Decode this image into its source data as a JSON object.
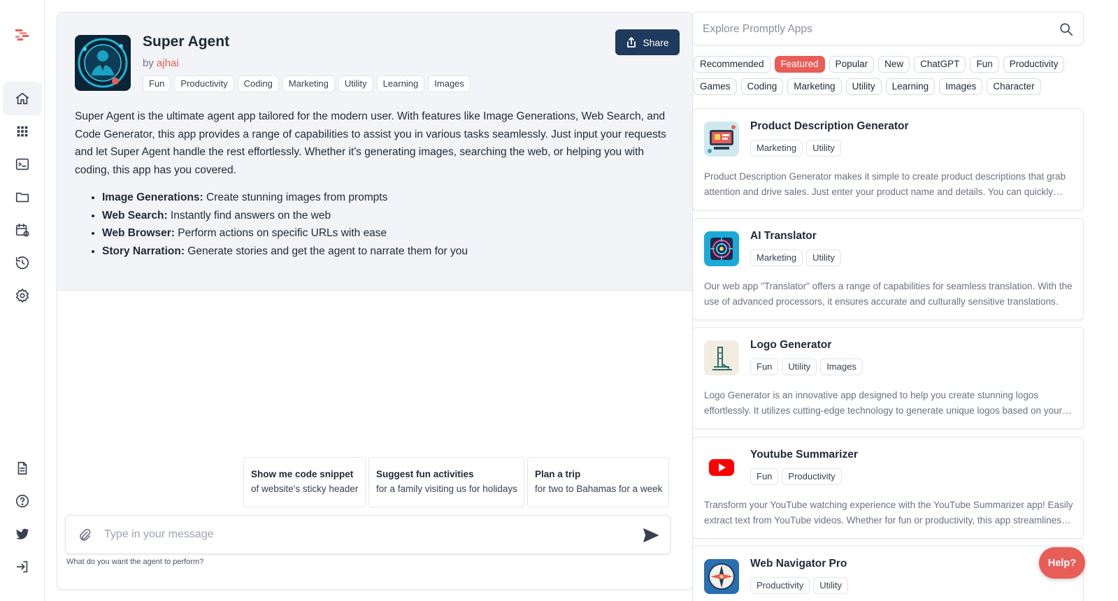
{
  "rail": {
    "items": [
      "home",
      "apps",
      "terminal",
      "folder",
      "calendar",
      "history",
      "settings",
      "docs",
      "help",
      "twitter",
      "login"
    ]
  },
  "agent": {
    "title": "Super Agent",
    "by_prefix": "by",
    "author": "ajhai",
    "tags": [
      "Fun",
      "Productivity",
      "Coding",
      "Marketing",
      "Utility",
      "Learning",
      "Images"
    ],
    "share_label": "Share",
    "description": "Super Agent is the ultimate agent app tailored for the modern user. With features like Image Generations, Web Search, and Code Generator, this app provides a range of capabilities to assist you in various tasks seamlessly. Just input your requests and let Super Agent handle the rest effortlessly. Whether it's generating images, searching the web, or helping you with coding, this app has you covered.",
    "features": [
      {
        "name": "Image Generations:",
        "text": "Create stunning images from prompts"
      },
      {
        "name": "Web Search:",
        "text": "Instantly find answers on the web"
      },
      {
        "name": "Web Browser:",
        "text": "Perform actions on specific URLs with ease"
      },
      {
        "name": "Story Narration:",
        "text": "Generate stories and get the agent to narrate them for you"
      }
    ]
  },
  "suggestions": [
    {
      "title": "Show me code snippet",
      "sub": "of website's sticky header"
    },
    {
      "title": "Suggest fun activities",
      "sub": "for a family visiting us for holidays"
    },
    {
      "title": "Plan a trip",
      "sub": "for two to Bahamas for a week"
    }
  ],
  "composer": {
    "placeholder": "Type in your message",
    "hint": "What do you want the agent to perform?"
  },
  "explore": {
    "placeholder": "Explore Promptly Apps",
    "filters": [
      "Recommended",
      "Featured",
      "Popular",
      "New",
      "ChatGPT",
      "Fun",
      "Productivity",
      "Games",
      "Coding",
      "Marketing",
      "Utility",
      "Learning",
      "Images",
      "Character"
    ],
    "active_filter": "Featured"
  },
  "apps": [
    {
      "title": "Product Description Generator",
      "tags": [
        "Marketing",
        "Utility"
      ],
      "desc": "Product Description Generator makes it simple to create product descriptions that grab attention and drive sales. Just enter your product name and details. You can quickly generate compelling descriptions."
    },
    {
      "title": "AI Translator",
      "tags": [
        "Marketing",
        "Utility"
      ],
      "desc": "Our web app \"Translator\" offers a range of capabilities for seamless translation. With the use of advanced processors, it ensures accurate and culturally sensitive translations."
    },
    {
      "title": "Logo Generator",
      "tags": [
        "Fun",
        "Utility",
        "Images"
      ],
      "desc": "Logo Generator is an innovative app designed to help you create stunning logos effortlessly. It utilizes cutting-edge technology to generate unique logos based on your input."
    },
    {
      "title": "Youtube Summarizer",
      "tags": [
        "Fun",
        "Productivity"
      ],
      "desc": "Transform your YouTube watching experience with the YouTube Summarizer app! Easily extract text from YouTube videos. Whether for fun or productivity, this app streamlines your workflow."
    },
    {
      "title": "Web Navigator Pro",
      "tags": [
        "Productivity",
        "Utility"
      ],
      "desc": ""
    }
  ],
  "help_label": "Help?",
  "colors": {
    "accent": "#e85d57",
    "share_bg": "#1e3a5c",
    "card_bg": "#f2f4f7"
  }
}
